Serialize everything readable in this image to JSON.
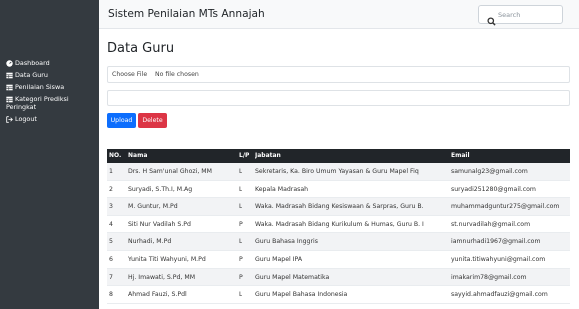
{
  "header": {
    "title": "Sistem Penilaian MTs Annajah",
    "search_placeholder": "Search"
  },
  "sidebar": {
    "items": [
      {
        "label": "Dashboard",
        "icon": "dashboard-icon"
      },
      {
        "label": "Data Guru",
        "icon": "table-icon"
      },
      {
        "label": "Penilaian Siswa",
        "icon": "table-icon"
      },
      {
        "label": "Kategori Prediksi",
        "label2": "Peringkat",
        "icon": "table-icon"
      },
      {
        "label": "Logout",
        "icon": "logout-icon"
      }
    ]
  },
  "main": {
    "page_title": "Data Guru",
    "file_button": "Choose File",
    "file_status": "No file chosen",
    "upload_label": "Upload",
    "delete_label": "Delete"
  },
  "table": {
    "columns": [
      "NO.",
      "Nama",
      "L/P",
      "Jabatan",
      "Email"
    ],
    "rows": [
      {
        "no": "1",
        "nama": "Drs. H Sam'unal Ghozi, MM",
        "lp": "L",
        "jabatan": "Sekretaris, Ka. Biro Umum Yayasan & Guru Mapel Fiq",
        "email": "samunalg23@gmail.com"
      },
      {
        "no": "2",
        "nama": "Suryadi, S.Th.I, M.Ag",
        "lp": "L",
        "jabatan": "Kepala Madrasah",
        "email": "suryadi251280@gmail.com"
      },
      {
        "no": "3",
        "nama": "M. Guntur, M.Pd",
        "lp": "L",
        "jabatan": "Waka. Madrasah Bidang Kesiswaan & Sarpras, Guru B.",
        "email": "muhammadguntur275@gmail.com"
      },
      {
        "no": "4",
        "nama": "Siti Nur Vadilah S.Pd",
        "lp": "P",
        "jabatan": "Waka. Madrasah Bidang Kurikulum & Humas, Guru B. I",
        "email": "st.nurvadilah@gmail.com"
      },
      {
        "no": "5",
        "nama": "Nurhadi, M.Pd",
        "lp": "L",
        "jabatan": "Guru Bahasa Inggris",
        "email": "iamnurhadi1967@gmail.com"
      },
      {
        "no": "6",
        "nama": "Yunita Titi Wahyuni, M.Pd",
        "lp": "P",
        "jabatan": "Guru Mapel IPA",
        "email": "yunita.titiwahyuni@gmail.com"
      },
      {
        "no": "7",
        "nama": "Hj. Imawati, S.Pd, MM",
        "lp": "P",
        "jabatan": "Guru Mapel Matematika",
        "email": "imakarim78@gmail.com"
      },
      {
        "no": "8",
        "nama": "Ahmad Fauzi, S.Pdl",
        "lp": "L",
        "jabatan": "Guru Mapel Bahasa Indonesia",
        "email": "sayyid.ahmadfauzi@gmail.com"
      }
    ]
  },
  "colors": {
    "sidebar_bg": "#343a40",
    "topbar_bg": "#f8f9fa",
    "primary": "#0d6efd",
    "danger": "#dc3545",
    "table_header_bg": "#212529"
  }
}
